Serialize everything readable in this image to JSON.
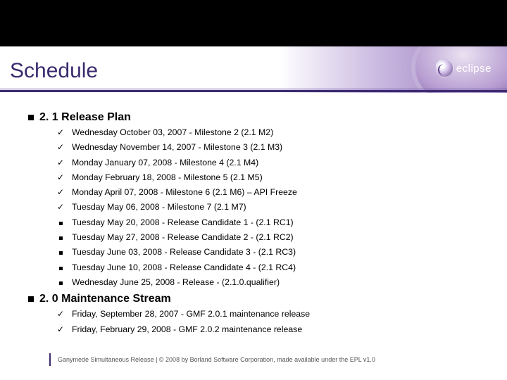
{
  "title": "Schedule",
  "logo_text": "eclipse",
  "section1": {
    "heading": "2. 1 Release Plan",
    "items": [
      {
        "bullet": "check",
        "text": "Wednesday October 03, 2007 - Milestone 2 (2.1 M2)"
      },
      {
        "bullet": "check",
        "text": "Wednesday November 14, 2007 - Milestone 3 (2.1 M3)"
      },
      {
        "bullet": "check",
        "text": "Monday January 07, 2008 - Milestone 4 (2.1 M4)"
      },
      {
        "bullet": "check",
        "text": "Monday February 18, 2008 - Milestone 5 (2.1 M5)"
      },
      {
        "bullet": "check",
        "text": "Monday April 07, 2008 - Milestone 6 (2.1 M6) – API Freeze"
      },
      {
        "bullet": "check",
        "text": "Tuesday May 06, 2008 - Milestone 7 (2.1 M7)"
      },
      {
        "bullet": "square",
        "text": "Tuesday May 20, 2008 - Release Candidate 1 - (2.1 RC1)"
      },
      {
        "bullet": "square",
        "text": "Tuesday May 27, 2008 - Release Candidate 2 - (2.1 RC2)"
      },
      {
        "bullet": "square",
        "text": "Tuesday June 03, 2008 - Release Candidate 3 - (2.1 RC3)"
      },
      {
        "bullet": "square",
        "text": "Tuesday June 10, 2008 - Release Candidate 4 - (2.1 RC4)"
      },
      {
        "bullet": "square",
        "text": "Wednesday June 25, 2008 - Release - (2.1.0.qualifier)"
      }
    ]
  },
  "section2": {
    "heading": "2. 0 Maintenance Stream",
    "items": [
      {
        "bullet": "check",
        "text": "Friday, September 28, 2007 - GMF 2.0.1 maintenance release"
      },
      {
        "bullet": "check",
        "text": "Friday, February 29, 2008 - GMF 2.0.2 maintenance release"
      }
    ]
  },
  "footer": "Ganymede Simultaneous Release |  © 2008 by Borland Software Corporation, made available under the EPL v1.0"
}
